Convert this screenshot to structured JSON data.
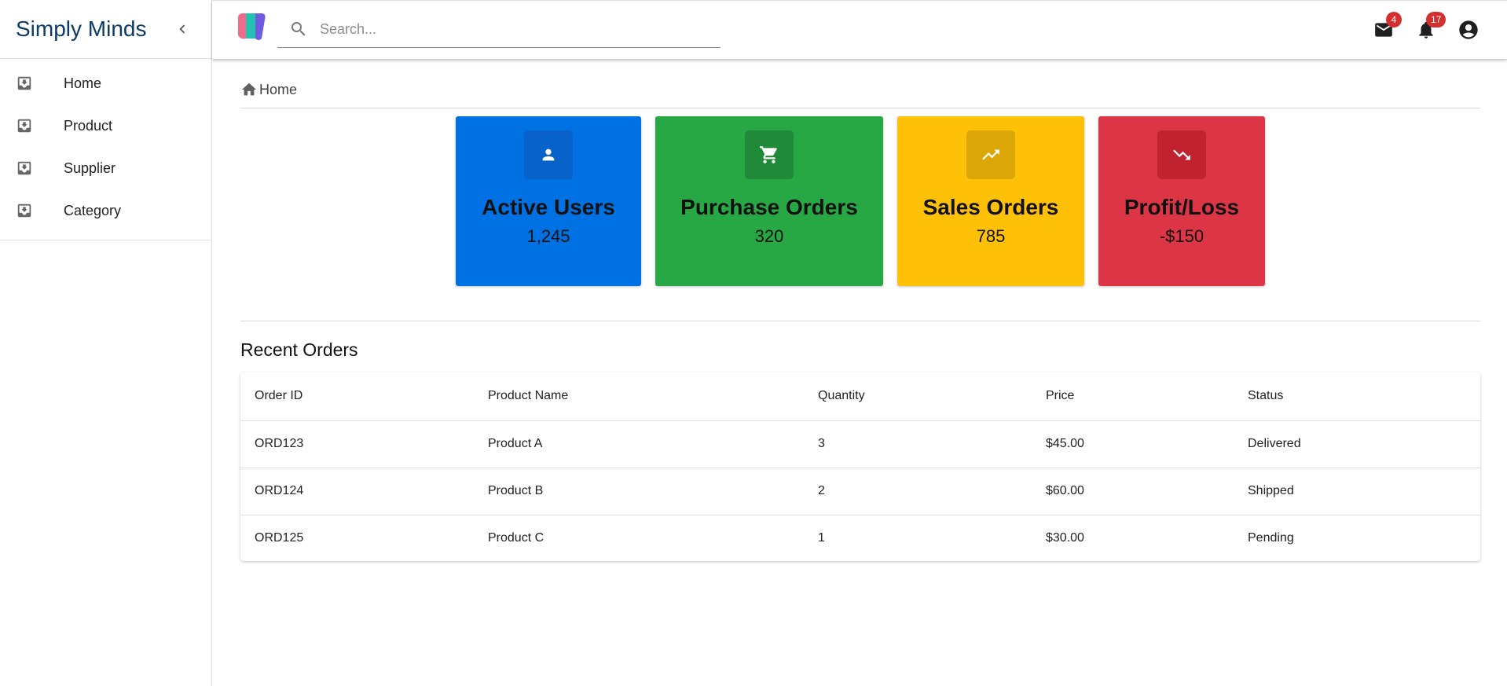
{
  "app": {
    "title": "Simply Minds"
  },
  "sidebar": {
    "collapse_icon": "chevron-left-icon",
    "items": [
      {
        "label": "Home",
        "icon": "move-to-inbox-icon"
      },
      {
        "label": "Product",
        "icon": "move-to-inbox-icon"
      },
      {
        "label": "Supplier",
        "icon": "move-to-inbox-icon"
      },
      {
        "label": "Category",
        "icon": "move-to-inbox-icon"
      }
    ]
  },
  "topbar": {
    "search": {
      "placeholder": "Search...",
      "value": ""
    },
    "mail": {
      "icon": "mail-icon",
      "badge": "4"
    },
    "notifications": {
      "icon": "bell-icon",
      "badge": "17"
    },
    "account": {
      "icon": "account-circle-icon"
    }
  },
  "breadcrumb": {
    "label": "Home",
    "icon": "home-icon"
  },
  "cards": [
    {
      "title": "Active Users",
      "value": "1,245",
      "icon": "person-icon",
      "color": "#0071e3",
      "icon_bg": "#0762c9"
    },
    {
      "title": "Purchase Orders",
      "value": "320",
      "icon": "cart-icon",
      "color": "#28a745",
      "icon_bg": "#218a38"
    },
    {
      "title": "Sales Orders",
      "value": "785",
      "icon": "trending-up-icon",
      "color": "#ffc107",
      "icon_bg": "#dba606"
    },
    {
      "title": "Profit/Loss",
      "value": "-$150",
      "icon": "trending-down-icon",
      "color": "#dc3545",
      "icon_bg": "#c0232f"
    }
  ],
  "recent_orders": {
    "title": "Recent Orders",
    "columns": [
      "Order ID",
      "Product Name",
      "Quantity",
      "Price",
      "Status"
    ],
    "rows": [
      [
        "ORD123",
        "Product A",
        "3",
        "$45.00",
        "Delivered"
      ],
      [
        "ORD124",
        "Product B",
        "2",
        "$60.00",
        "Shipped"
      ],
      [
        "ORD125",
        "Product C",
        "1",
        "$30.00",
        "Pending"
      ]
    ]
  }
}
